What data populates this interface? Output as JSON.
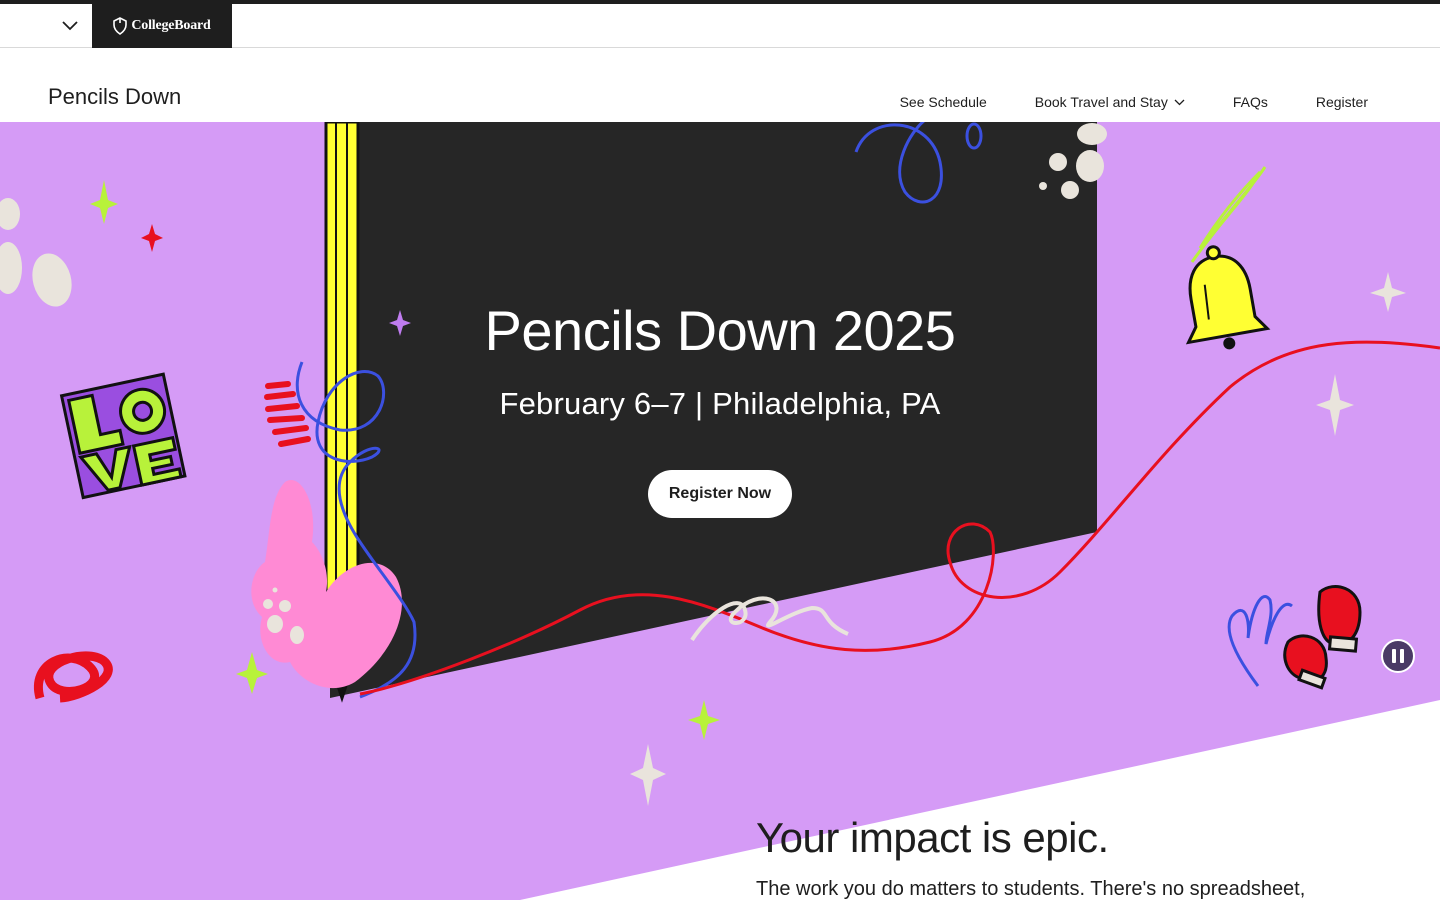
{
  "global_nav": {
    "toggle_icon": "chevron-down-icon",
    "logo_text": "CollegeBoard",
    "logo_icon": "acorn-icon"
  },
  "header": {
    "title": "Pencils Down",
    "nav": [
      {
        "label": "See Schedule"
      },
      {
        "label": "Book Travel and Stay",
        "icon": "chevron-down-icon"
      },
      {
        "label": "FAQs"
      },
      {
        "label": "Register"
      }
    ]
  },
  "hero": {
    "title": "Pencils Down 2025",
    "subtitle": "February 6–7 | Philadelphia, PA",
    "cta_label": "Register Now",
    "pause_icon": "pause-icon"
  },
  "impact": {
    "heading": "Your impact is epic.",
    "text": "The work you do matters to students. There's no spreadsheet,"
  },
  "colors": {
    "purple": "#d59bf6",
    "dark": "#262626",
    "red": "#e8101f",
    "blue": "#3b50e0",
    "lime": "#b8f23a",
    "yellow": "#ffff33",
    "pink": "#ff8ad4",
    "white": "#ffffff"
  }
}
